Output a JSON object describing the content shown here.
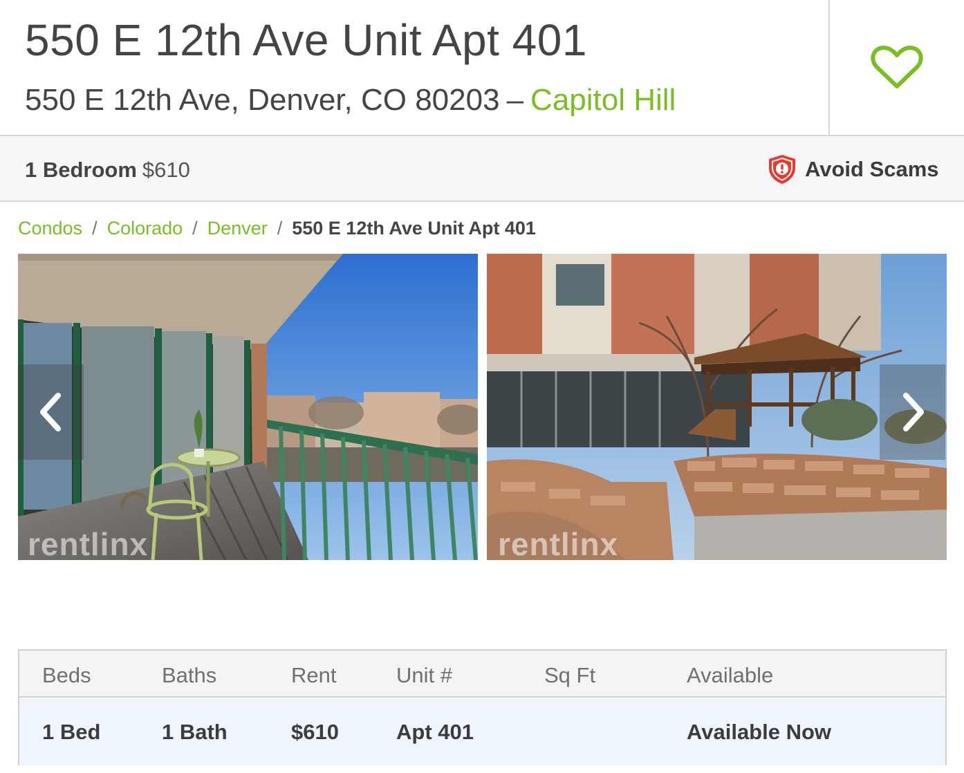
{
  "header": {
    "title": "550 E 12th Ave Unit Apt 401",
    "address": "550 E 12th Ave, Denver, CO 80203",
    "separator": "–",
    "neighborhood": "Capitol Hill"
  },
  "summary": {
    "beds": "1 Bedroom",
    "price": "$610",
    "scams_label": "Avoid Scams"
  },
  "breadcrumb": {
    "items": [
      "Condos",
      "Colorado",
      "Denver"
    ],
    "current": "550 E 12th Ave Unit Apt 401",
    "separator": "/"
  },
  "gallery": {
    "watermark": "rentlinx"
  },
  "units_table": {
    "headers": [
      "Beds",
      "Baths",
      "Rent",
      "Unit #",
      "Sq Ft",
      "Available"
    ],
    "rows": [
      [
        "1 Bed",
        "1 Bath",
        "$610",
        "Apt 401",
        "",
        "Available Now"
      ]
    ]
  },
  "icons": {
    "favorite": "heart-icon",
    "scams": "shield-alert-icon",
    "prev": "chevron-left-icon",
    "next": "chevron-right-icon"
  },
  "colors": {
    "accent_green": "#7bbe24",
    "shield_red": "#e8392f",
    "row_highlight": "#eef5fc"
  }
}
